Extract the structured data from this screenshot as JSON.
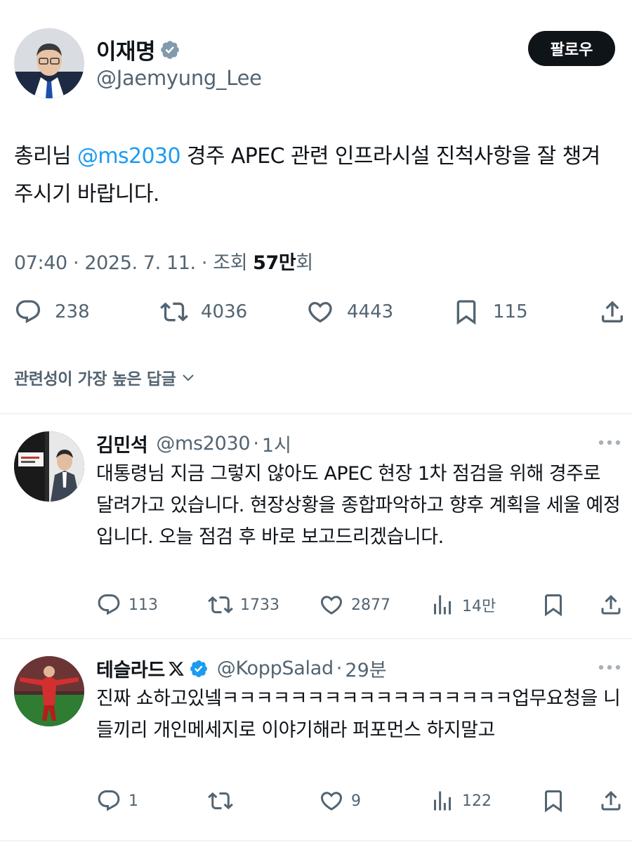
{
  "post": {
    "author_name": "이재명",
    "author_handle": "@Jaemyung_Lee",
    "follow_label": "팔로우",
    "text_before": "총리님 ",
    "mention": "@ms2030",
    "text_after": " 경주 APEC 관련 인프라시설 진척사항을 잘 챙겨주시기 바랍니다.",
    "timestamp": "07:40 · 2025. 7. 11. · 조회",
    "views": "57만",
    "views_suffix": "회",
    "replies": "238",
    "reposts": "4036",
    "likes": "4443",
    "bookmarks": "115"
  },
  "sort": {
    "label": "관련성이 가장 높은 답글"
  },
  "replies": [
    {
      "name": "김민석",
      "handle": "@ms2030",
      "dot": "·",
      "time": "1시",
      "text": "대통령님 지금 그렇지 않아도 APEC 현장 1차 점검을 위해 경주로 달려가고 있습니다. 현장상황을 종합파악하고 향후 계획을 세울 예정입니다. 오늘 점검 후 바로 보고드리겠습니다.",
      "replies": "113",
      "reposts": "1733",
      "likes": "2877",
      "views": "14만"
    },
    {
      "name": "테슬라드",
      "handle": "@KoppSalad",
      "dot": "·",
      "time": "29분",
      "text": "진짜 쇼하고있넼ㅋㅋㅋㅋㅋㅋㅋㅋㅋㅋㅋㅋㅋㅋㅋㅋㅋ업무요청을 니들끼리 개인메세지로 이야기해라 퍼포먼스 하지말고",
      "replies": "1",
      "reposts": "",
      "likes": "9",
      "views": "122"
    }
  ],
  "colors": {
    "accent": "#1d9bf0",
    "text": "#0f1419",
    "muted": "#536471",
    "divider": "#eff3f4"
  }
}
